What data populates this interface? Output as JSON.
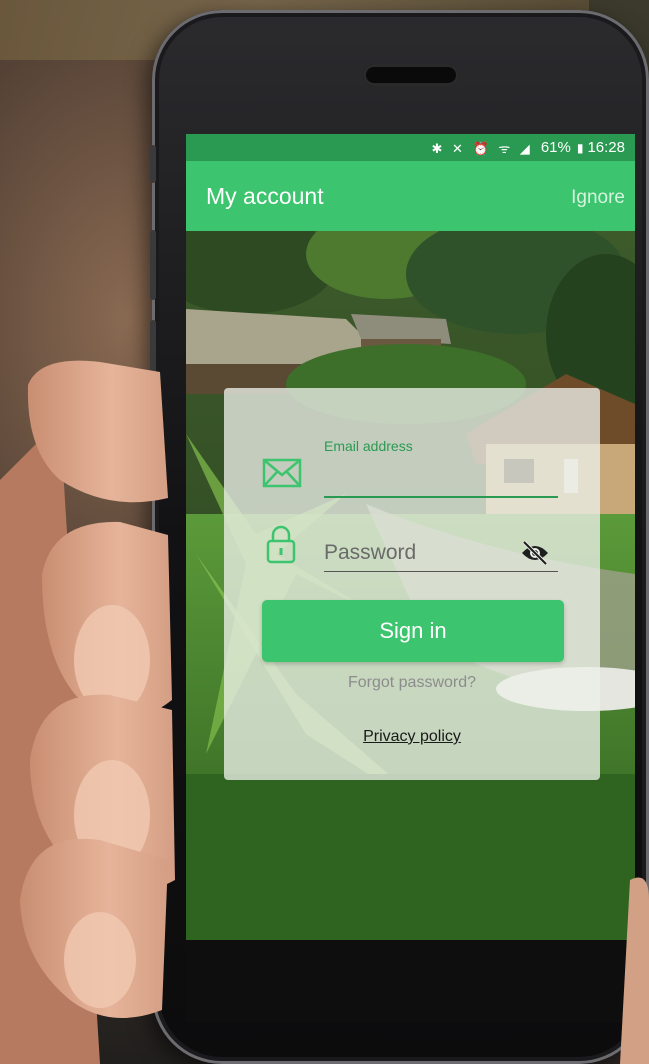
{
  "status_bar": {
    "icons": "✱ ✕ ⏰ ᯤ ◢",
    "battery": "61%",
    "time": "16:28"
  },
  "app_bar": {
    "title": "My account",
    "ignore": "Ignore"
  },
  "login": {
    "email_label": "Email address",
    "password_placeholder": "Password",
    "sign_in": "Sign in",
    "forgot_password": "Forgot password?",
    "privacy_policy": "Privacy policy"
  },
  "icons": {
    "email": "envelope-icon",
    "password": "lock-icon",
    "visibility": "eye-off-icon"
  },
  "colors": {
    "accent": "#3dc46e",
    "status_bar": "#2a9a52"
  }
}
